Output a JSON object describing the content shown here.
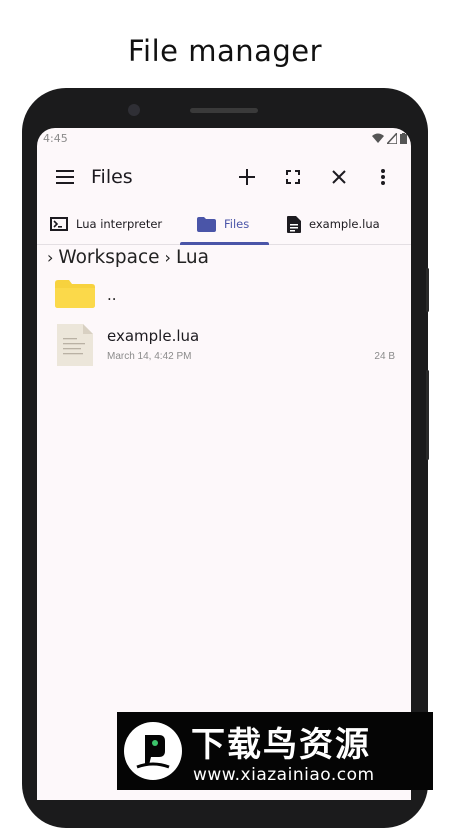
{
  "promo": {
    "title": "File manager"
  },
  "status_bar": {
    "time": "4:45"
  },
  "app_bar": {
    "title": "Files",
    "icons": [
      "menu-icon",
      "add-icon",
      "fullscreen-icon",
      "close-icon",
      "more-vert-icon"
    ]
  },
  "tabs": [
    {
      "label": "Lua interpreter",
      "icon": "terminal-icon",
      "active": false
    },
    {
      "label": "Files",
      "icon": "folder-icon",
      "active": true
    },
    {
      "label": "example.lua",
      "icon": "document-icon",
      "active": false
    }
  ],
  "breadcrumb": [
    "Workspace",
    "Lua"
  ],
  "entries": {
    "parent": {
      "name": "..",
      "icon": "folder-icon"
    },
    "file": {
      "name": "example.lua",
      "date": "March 14, 4:42 PM",
      "size": "24 B",
      "icon": "text-file-icon"
    }
  },
  "colors": {
    "accent": "#4a55a8",
    "folder": "#f7d23e",
    "screen_bg": "#fdf8fa"
  },
  "watermark": {
    "text": "下载鸟资源",
    "url": "www.xiazainiao.com"
  }
}
